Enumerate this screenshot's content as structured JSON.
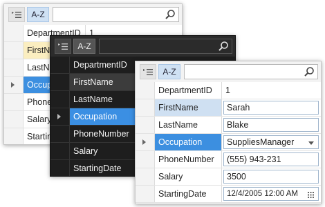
{
  "toolbar": {
    "categorized_icon": "categorized-list-icon",
    "sort_label": "A-Z",
    "search_icon": "search-icon",
    "search_value": ""
  },
  "panel_back": {
    "rows": [
      {
        "name": "DepartmentID",
        "value": "1"
      },
      {
        "name": "FirstNa",
        "value": ""
      },
      {
        "name": "LastNa",
        "value": ""
      },
      {
        "name": "Occupa",
        "value": ""
      },
      {
        "name": "PhoneN",
        "value": ""
      },
      {
        "name": "Salary",
        "value": ""
      },
      {
        "name": "Starting",
        "value": ""
      }
    ]
  },
  "panel_dark": {
    "rows": [
      {
        "name": "DepartmentID"
      },
      {
        "name": "FirstName"
      },
      {
        "name": "LastName"
      },
      {
        "name": "Occupation"
      },
      {
        "name": "PhoneNumber"
      },
      {
        "name": "Salary"
      },
      {
        "name": "StartingDate"
      }
    ]
  },
  "panel_front": {
    "rows": [
      {
        "name": "DepartmentID",
        "value": "1"
      },
      {
        "name": "FirstName",
        "value": "Sarah"
      },
      {
        "name": "LastName",
        "value": "Blake"
      },
      {
        "name": "Occupation",
        "value": "SuppliesManager"
      },
      {
        "name": "PhoneNumber",
        "value": "(555) 943-231"
      },
      {
        "name": "Salary",
        "value": "3500"
      },
      {
        "name": "StartingDate",
        "value": "12/4/2005 12:00 AM"
      }
    ]
  },
  "colors": {
    "accent": "#3c8fe0",
    "soft_highlight": "#cfe0f2",
    "dark_background": "#1e1e1e"
  }
}
